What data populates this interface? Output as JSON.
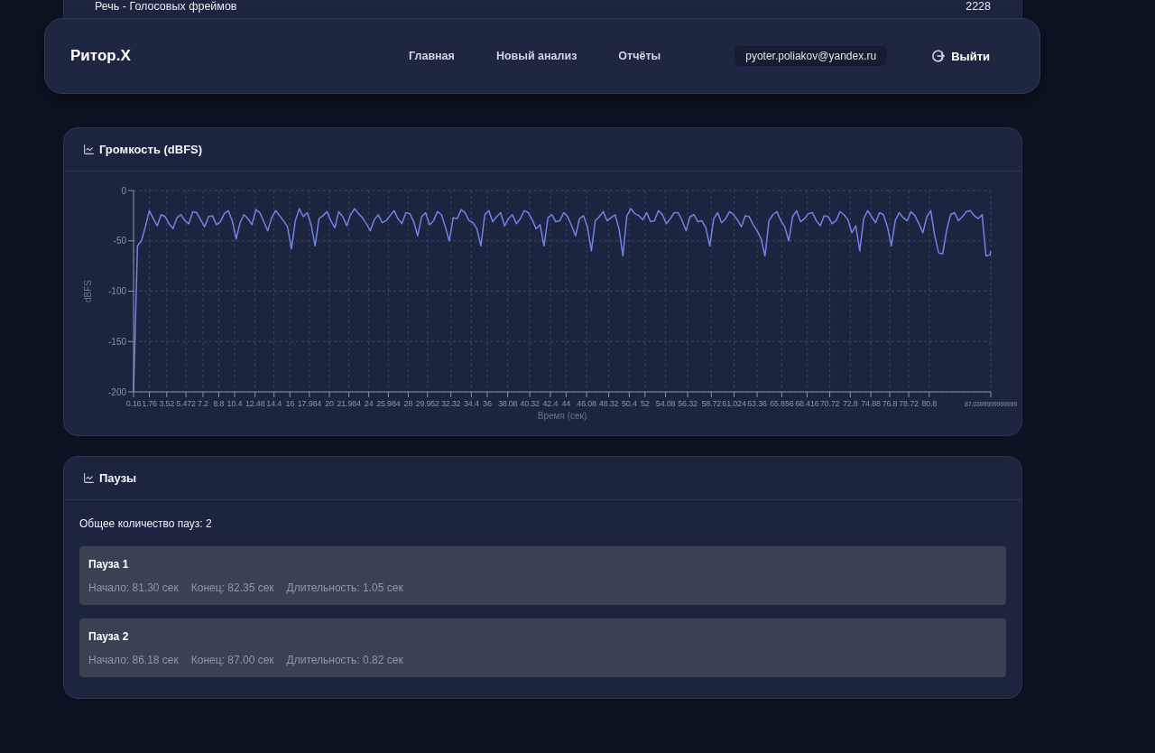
{
  "top_table": {
    "rows": [
      {
        "label": "Речь - Голосовых фреймов",
        "value": "2228"
      }
    ]
  },
  "header": {
    "logo": "Ритор.X",
    "nav": [
      {
        "label": "Главная"
      },
      {
        "label": "Новый анализ"
      },
      {
        "label": "Отчёты"
      }
    ],
    "user_email": "pyoter.poliakov@yandex.ru",
    "logout": "Выйти"
  },
  "loudness_card": {
    "title": "Громкость (dBFS)",
    "chart_data": {
      "type": "line",
      "grid": true,
      "xlabel": "Время (сек)",
      "ylabel": "dBFS",
      "xlim": [
        0.16,
        87.04
      ],
      "ylim": [
        -200,
        0
      ],
      "yticks": [
        0,
        -50,
        -100,
        -150,
        -200
      ],
      "xticks": [
        0.16,
        1.76,
        3.52,
        5.472,
        7.2,
        8.8,
        10.4,
        12.48,
        14.4,
        16,
        17.984,
        20,
        21.984,
        24,
        25.984,
        28,
        29.952,
        32.32,
        34.4,
        36,
        38.08,
        40.32,
        42.4,
        44,
        46.08,
        48.32,
        50.4,
        52,
        54.08,
        56.32,
        58.72,
        61.024,
        63.36,
        65.856,
        68.416,
        70.72,
        72.8,
        74.88,
        76.8,
        78.72,
        80.8,
        {
          "value": 87.04,
          "label": "87.0399999999999"
        }
      ],
      "x": [
        0.16,
        0.56,
        0.96,
        1.36,
        1.76,
        2.16,
        2.56,
        2.96,
        3.36,
        3.76,
        4.16,
        4.56,
        4.96,
        5.36,
        5.76,
        6.16,
        6.56,
        6.96,
        7.36,
        7.76,
        8.16,
        8.56,
        8.96,
        9.36,
        9.76,
        10.16,
        10.56,
        10.96,
        11.36,
        11.76,
        12.16,
        12.56,
        12.96,
        13.36,
        13.76,
        14.16,
        14.56,
        14.96,
        15.36,
        15.76,
        16.16,
        16.56,
        16.96,
        17.36,
        17.76,
        18.16,
        18.56,
        18.96,
        19.36,
        19.76,
        20.16,
        20.56,
        20.96,
        21.36,
        21.76,
        22.16,
        22.56,
        22.96,
        23.36,
        23.76,
        24.16,
        24.56,
        24.96,
        25.36,
        25.76,
        26.16,
        26.56,
        26.96,
        27.36,
        27.76,
        28.16,
        28.56,
        28.96,
        29.36,
        29.76,
        30.16,
        30.56,
        30.96,
        31.36,
        31.76,
        32.16,
        32.56,
        32.96,
        33.36,
        33.76,
        34.16,
        34.56,
        34.96,
        35.36,
        35.76,
        36.16,
        36.56,
        36.96,
        37.36,
        37.76,
        38.16,
        38.56,
        38.96,
        39.36,
        39.76,
        40.16,
        40.56,
        40.96,
        41.36,
        41.76,
        42.16,
        42.56,
        42.96,
        43.36,
        43.76,
        44.16,
        44.56,
        44.96,
        45.36,
        45.76,
        46.16,
        46.56,
        46.96,
        47.36,
        47.76,
        48.16,
        48.56,
        48.96,
        49.36,
        49.76,
        50.16,
        50.56,
        50.96,
        51.36,
        51.76,
        52.16,
        52.56,
        52.96,
        53.36,
        53.76,
        54.16,
        54.56,
        54.96,
        55.36,
        55.76,
        56.16,
        56.56,
        56.96,
        57.36,
        57.76,
        58.16,
        58.56,
        58.96,
        59.36,
        59.76,
        60.16,
        60.56,
        60.96,
        61.36,
        61.76,
        62.16,
        62.56,
        62.96,
        63.36,
        63.76,
        64.16,
        64.56,
        64.96,
        65.36,
        65.76,
        66.16,
        66.56,
        66.96,
        67.36,
        67.76,
        68.16,
        68.56,
        68.96,
        69.36,
        69.76,
        70.16,
        70.56,
        70.96,
        71.36,
        71.76,
        72.16,
        72.56,
        72.96,
        73.36,
        73.76,
        74.16,
        74.56,
        74.96,
        75.36,
        75.76,
        76.16,
        76.56,
        76.96,
        77.36,
        77.76,
        78.16,
        78.56,
        78.96,
        79.36,
        79.76,
        80.16,
        80.56,
        80.96,
        81.36,
        81.76,
        82.16,
        82.56,
        82.96,
        83.36,
        83.76,
        84.16,
        84.56,
        84.96,
        85.36,
        85.76,
        86.16,
        86.56,
        86.96,
        87.04
      ],
      "series": [
        {
          "color": "#7282e6",
          "values": [
            -200,
            -55,
            -50,
            -36,
            -20,
            -28,
            -35,
            -24,
            -26,
            -33,
            -38,
            -27,
            -24,
            -30,
            -33,
            -21,
            -22,
            -29,
            -36,
            -26,
            -25,
            -34,
            -31,
            -23,
            -20,
            -30,
            -48,
            -32,
            -24,
            -28,
            -34,
            -19,
            -22,
            -31,
            -40,
            -27,
            -20,
            -25,
            -30,
            -36,
            -58,
            -30,
            -18,
            -26,
            -22,
            -34,
            -55,
            -28,
            -25,
            -21,
            -30,
            -37,
            -21,
            -26,
            -35,
            -24,
            -18,
            -23,
            -27,
            -33,
            -40,
            -29,
            -24,
            -32,
            -30,
            -25,
            -20,
            -28,
            -33,
            -22,
            -23,
            -31,
            -45,
            -26,
            -22,
            -34,
            -30,
            -21,
            -24,
            -36,
            -50,
            -27,
            -28,
            -19,
            -22,
            -30,
            -32,
            -38,
            -55,
            -24,
            -20,
            -31,
            -26,
            -22,
            -35,
            -28,
            -24,
            -33,
            -28,
            -20,
            -22,
            -29,
            -38,
            -34,
            -55,
            -27,
            -24,
            -31,
            -30,
            -22,
            -26,
            -35,
            -45,
            -28,
            -25,
            -36,
            -60,
            -30,
            -26,
            -21,
            -30,
            -27,
            -24,
            -38,
            -65,
            -25,
            -18,
            -23,
            -25,
            -29,
            -22,
            -31,
            -30,
            -20,
            -24,
            -33,
            -28,
            -22,
            -22,
            -30,
            -40,
            -26,
            -24,
            -31,
            -30,
            -37,
            -55,
            -28,
            -22,
            -32,
            -28,
            -21,
            -24,
            -29,
            -36,
            -25,
            -26,
            -34,
            -40,
            -48,
            -65,
            -30,
            -24,
            -21,
            -30,
            -36,
            -50,
            -26,
            -20,
            -31,
            -28,
            -23,
            -22,
            -30,
            -35,
            -25,
            -26,
            -33,
            -30,
            -21,
            -24,
            -29,
            -42,
            -35,
            -60,
            -28,
            -20,
            -26,
            -32,
            -22,
            -24,
            -36,
            -55,
            -30,
            -22,
            -27,
            -30,
            -21,
            -25,
            -33,
            -42,
            -26,
            -20,
            -45,
            -62,
            -63,
            -40,
            -24,
            -22,
            -30,
            -26,
            -21,
            -20,
            -25,
            -28,
            -24,
            -65,
            -64,
            -60
          ]
        }
      ]
    }
  },
  "pauses_card": {
    "title": "Паузы",
    "total": "Общее количество пауз: 2",
    "pauses": [
      {
        "title": "Пауза 1",
        "start": "Начало: 81.30 сек",
        "end": "Конец: 82.35 сек",
        "duration": "Длительность: 1.05 сек"
      },
      {
        "title": "Пауза 2",
        "start": "Начало: 86.18 сек",
        "end": "Конец: 87.00 сек",
        "duration": "Длительность: 0.82 сек"
      }
    ]
  }
}
